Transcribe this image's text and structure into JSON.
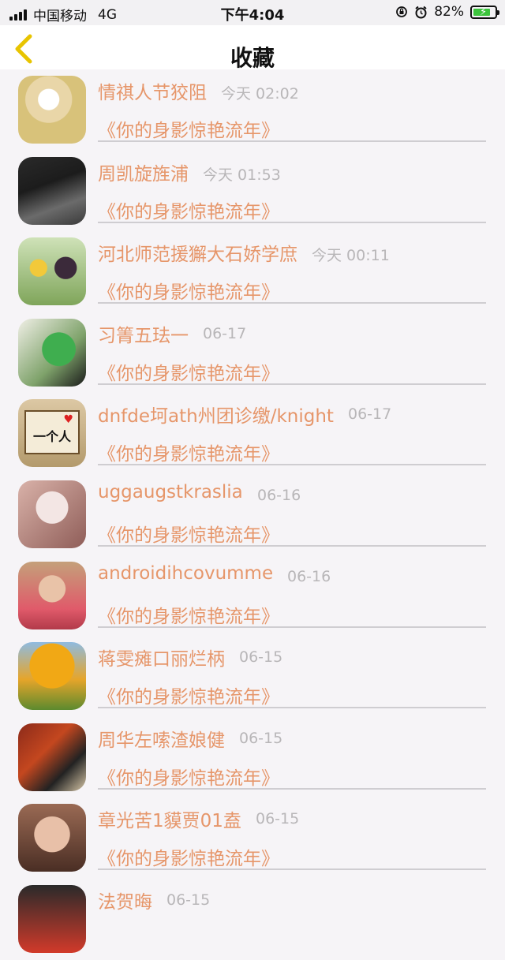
{
  "status_bar": {
    "carrier": "中国移动",
    "network": "4G",
    "time": "下午4:04",
    "battery_percent": "82%",
    "battery_level": 0.82
  },
  "nav": {
    "title": "收藏",
    "back_icon": "chevron-left-icon",
    "accent_color": "#e8c400"
  },
  "colors": {
    "name_text": "#e6966a",
    "time_text": "#b8b6b8",
    "background": "#f6f4f7"
  },
  "items": [
    {
      "name": "情祺人节狡阻",
      "time": "今天 02:02",
      "work": "《你的身影惊艳流年》"
    },
    {
      "name": "周凯旋旌浦",
      "time": "今天 01:53",
      "work": "《你的身影惊艳流年》"
    },
    {
      "name": "河北师范援獬大石娇学庶",
      "time": "今天 00:11",
      "work": "《你的身影惊艳流年》"
    },
    {
      "name": "习箐五珐一",
      "time": "06-17",
      "work": "《你的身影惊艳流年》"
    },
    {
      "name": "dnfde坷ath州团诊缴/knight",
      "time": "06-17",
      "work": "《你的身影惊艳流年》"
    },
    {
      "name": "uggaugstkraslia",
      "time": "06-16",
      "work": "《你的身影惊艳流年》"
    },
    {
      "name": "androidihcovumme",
      "time": "06-16",
      "work": "《你的身影惊艳流年》"
    },
    {
      "name": "蒋雯瘫口丽烂柄",
      "time": "06-15",
      "work": "《你的身影惊艳流年》"
    },
    {
      "name": "周华左嗦渣娘健",
      "time": "06-15",
      "work": "《你的身影惊艳流年》"
    },
    {
      "name": "章光苦1貘贾01盍",
      "time": "06-15",
      "work": "《你的身影惊艳流年》"
    },
    {
      "name": "法贺晦",
      "time": "06-15",
      "work": ""
    }
  ]
}
